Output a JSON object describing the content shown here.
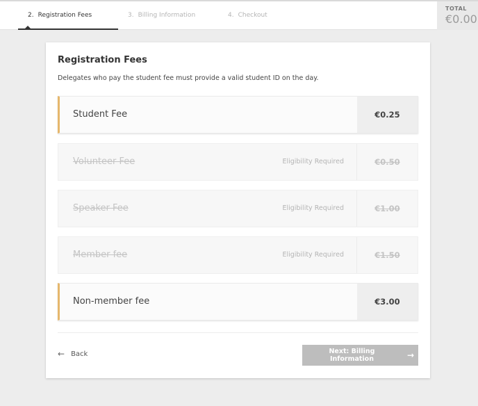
{
  "steps": [
    {
      "num": "2.",
      "label": "Registration Fees",
      "active": true
    },
    {
      "num": "3.",
      "label": "Billing Information",
      "active": false
    },
    {
      "num": "4.",
      "label": "Checkout",
      "active": false
    }
  ],
  "total": {
    "label": "TOTAL",
    "amount": "€0.00"
  },
  "card": {
    "title": "Registration Fees",
    "description": "Delegates who pay the student fee must provide a valid student ID on the day."
  },
  "fees": [
    {
      "name": "Student Fee",
      "price": "€0.25",
      "eligibility": "",
      "disabled": false
    },
    {
      "name": "Volunteer Fee",
      "price": "€0.50",
      "eligibility": "Eligibility Required",
      "disabled": true
    },
    {
      "name": "Speaker Fee",
      "price": "€1.00",
      "eligibility": "Eligibility Required",
      "disabled": true
    },
    {
      "name": "Member fee",
      "price": "€1.50",
      "eligibility": "Eligibility Required",
      "disabled": true
    },
    {
      "name": "Non-member fee",
      "price": "€3.00",
      "eligibility": "",
      "disabled": false
    }
  ],
  "nav": {
    "back_label": "Back",
    "back_icon": "arrow-left-icon",
    "next_label": "Next: Billing Information",
    "next_icon": "arrow-right-icon"
  },
  "colors": {
    "accent": "#e6b76c",
    "button_disabled": "#bdbdbd",
    "background": "#ededed"
  }
}
